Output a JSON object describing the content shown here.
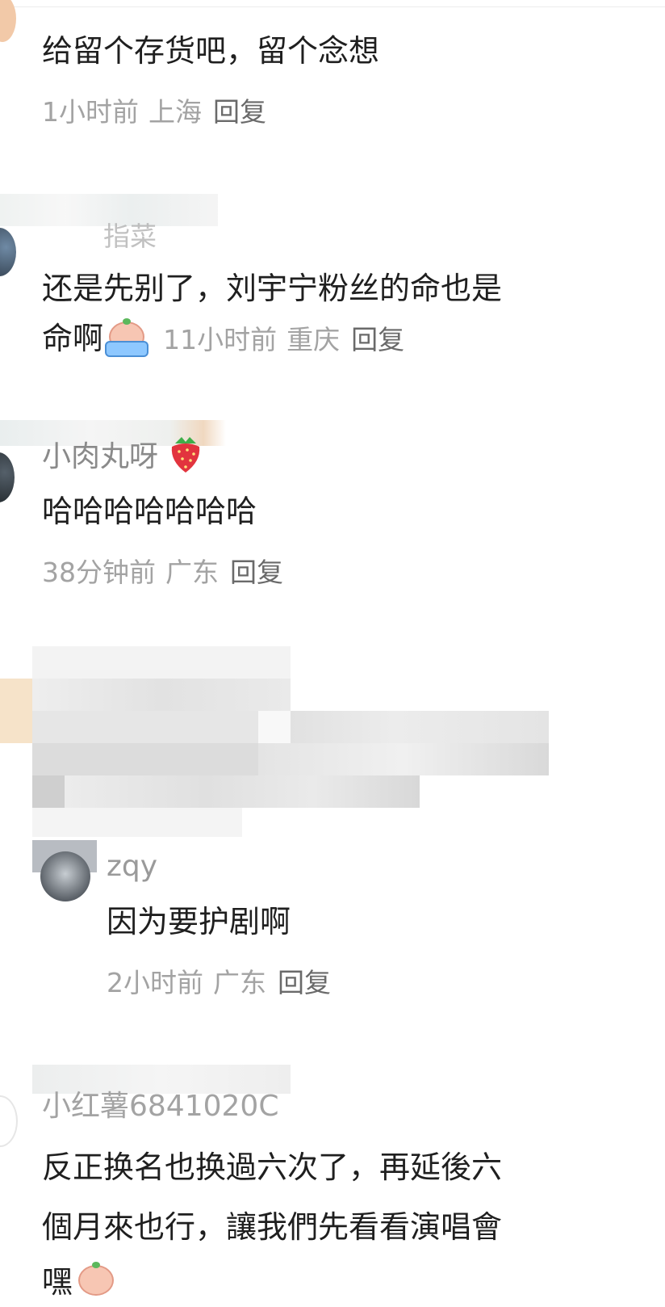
{
  "comments": [
    {
      "text": "给留个存货吧，留个念想",
      "time": "1小时前",
      "location": "上海",
      "reply_label": "回复"
    },
    {
      "username": "指菜",
      "text_line1": "还是先别了，刘宇宁粉丝的命也是",
      "text_line2": "命啊",
      "emoji": "crying-peach-emoji",
      "time": "11小时前",
      "location": "重庆",
      "reply_label": "回复"
    },
    {
      "username": "小肉丸呀",
      "badge_emoji": "strawberry-emoji",
      "text": "哈哈哈哈哈哈哈",
      "time": "38分钟前",
      "location": "广东",
      "reply_label": "回复"
    },
    {
      "blurred": true,
      "reply": {
        "username": "zqy",
        "text": "因为要护剧啊",
        "time": "2小时前",
        "location": "广东",
        "reply_label": "回复"
      }
    },
    {
      "username": "小红薯6841020C",
      "text_line1": "反正换名也换過六次了，再延後六",
      "text_line2": "個月來也行，讓我們先看看演唱會",
      "text_line3": "嘿"
    }
  ]
}
